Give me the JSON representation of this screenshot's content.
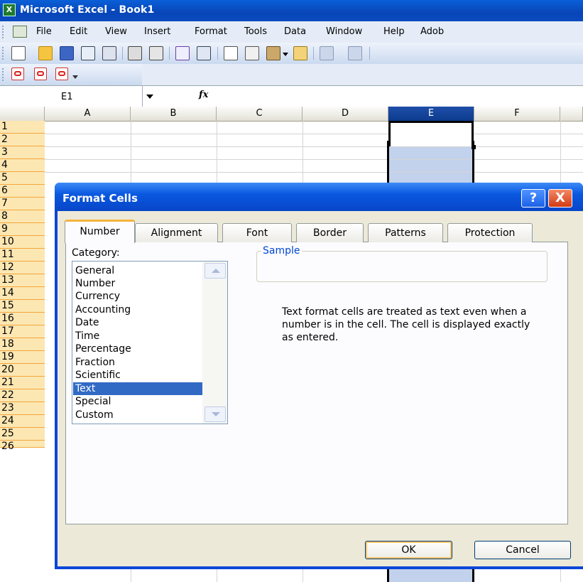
{
  "window": {
    "title": "Microsoft Excel - Book1",
    "app_icon": "excel-icon"
  },
  "menu": {
    "items": [
      {
        "label": "File"
      },
      {
        "label": "Edit"
      },
      {
        "label": "View"
      },
      {
        "label": "Insert"
      },
      {
        "label": "Format"
      },
      {
        "label": "Tools"
      },
      {
        "label": "Data"
      },
      {
        "label": "Window"
      },
      {
        "label": "Help"
      },
      {
        "label": "Adob"
      }
    ]
  },
  "toolbar": {
    "icons": [
      "new-icon",
      "open-icon",
      "save-icon",
      "permission-icon",
      "email-icon",
      "print-icon",
      "print-preview-icon",
      "spelling-icon",
      "research-icon",
      "cut-icon",
      "copy-icon",
      "paste-icon",
      "format-painter-icon",
      "undo-icon",
      "redo-icon"
    ],
    "pdf_icons": [
      "pdf-create-icon",
      "pdf-email-icon",
      "pdf-review-icon"
    ]
  },
  "formula_bar": {
    "name_box": "E1",
    "fx_label": "fx",
    "value": ""
  },
  "grid": {
    "columns": [
      "A",
      "B",
      "C",
      "D",
      "E",
      "F"
    ],
    "selected_column": "E",
    "rows": [
      "1",
      "2",
      "3",
      "4",
      "5",
      "6",
      "7",
      "8",
      "9",
      "10",
      "11",
      "12",
      "13",
      "14",
      "15",
      "16",
      "17",
      "18",
      "19",
      "20",
      "21",
      "22",
      "23",
      "24",
      "25",
      "26"
    ]
  },
  "dialog": {
    "title": "Format Cells",
    "help_label": "?",
    "close_label": "X",
    "tabs": [
      {
        "label": "Number",
        "active": true
      },
      {
        "label": "Alignment"
      },
      {
        "label": "Font"
      },
      {
        "label": "Border"
      },
      {
        "label": "Patterns"
      },
      {
        "label": "Protection"
      }
    ],
    "category_label": "Category:",
    "categories": [
      {
        "label": "General"
      },
      {
        "label": "Number"
      },
      {
        "label": "Currency"
      },
      {
        "label": "Accounting"
      },
      {
        "label": "Date"
      },
      {
        "label": "Time"
      },
      {
        "label": "Percentage"
      },
      {
        "label": "Fraction"
      },
      {
        "label": "Scientific"
      },
      {
        "label": "Text",
        "selected": true
      },
      {
        "label": "Special"
      },
      {
        "label": "Custom"
      }
    ],
    "sample_label": "Sample",
    "description": "Text format cells are treated as text even when a number is in the cell.  The cell is displayed exactly as entered.",
    "ok_label": "OK",
    "cancel_label": "Cancel"
  }
}
